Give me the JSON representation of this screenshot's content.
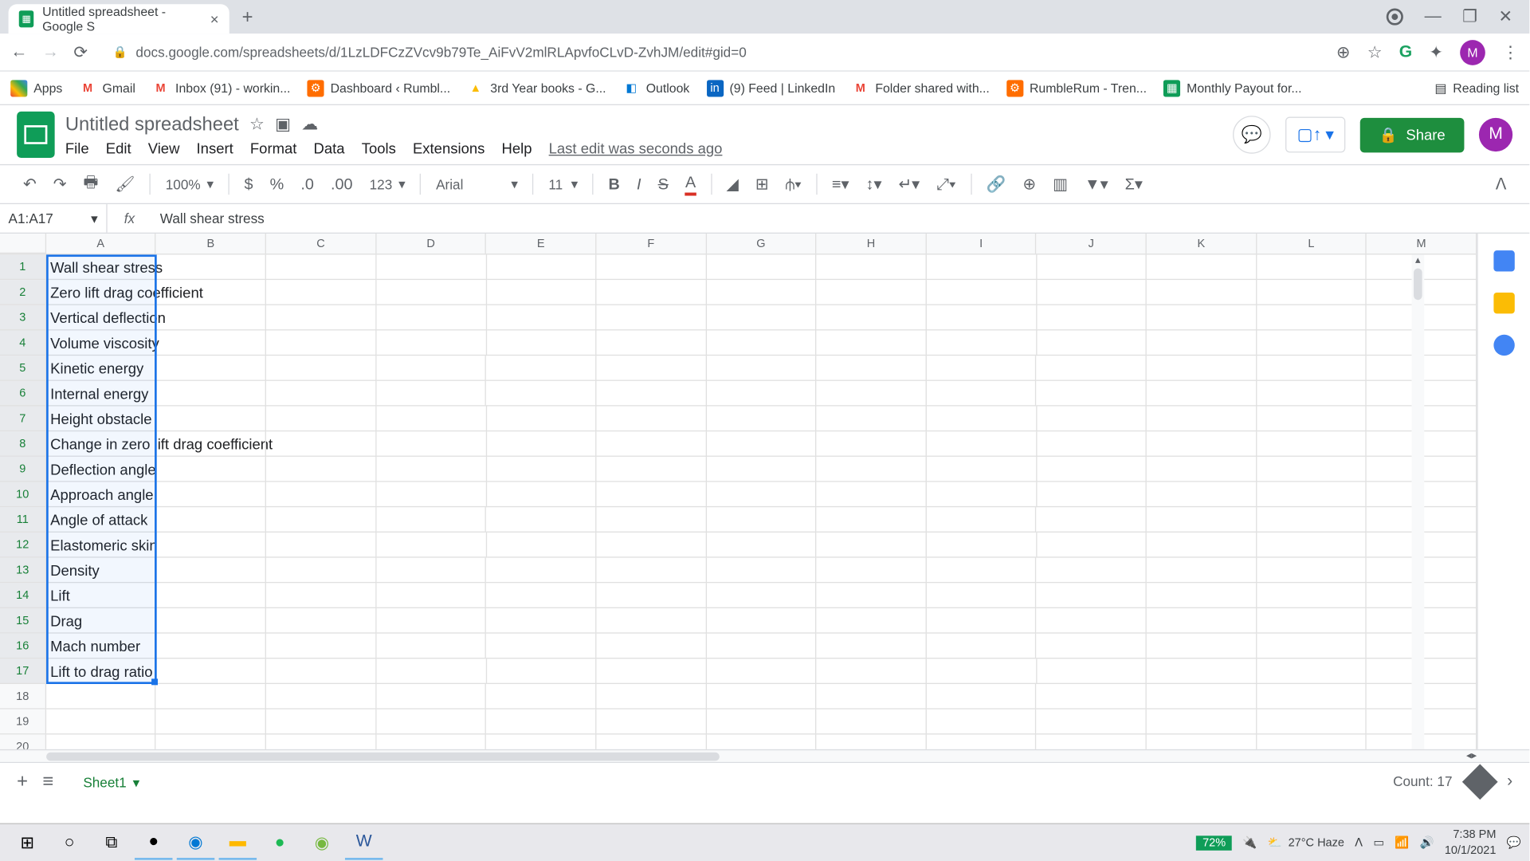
{
  "browser": {
    "tab_title": "Untitled spreadsheet - Google S",
    "url": "docs.google.com/spreadsheets/d/1LzLDFCzZVcv9b79Te_AiFvV2mlRLApvfoCLvD-ZvhJM/edit#gid=0",
    "bookmarks": [
      {
        "label": "Apps",
        "icon": "apps"
      },
      {
        "label": "Gmail",
        "icon": "gmail"
      },
      {
        "label": "Inbox (91) - workin...",
        "icon": "gmail"
      },
      {
        "label": "Dashboard ‹ Rumbl...",
        "icon": "orange"
      },
      {
        "label": "3rd Year books - G...",
        "icon": "drive"
      },
      {
        "label": "Outlook",
        "icon": "outlook"
      },
      {
        "label": "(9) Feed | LinkedIn",
        "icon": "linkedin"
      },
      {
        "label": "Folder shared with...",
        "icon": "gmail"
      },
      {
        "label": "RumbleRum - Tren...",
        "icon": "orange"
      },
      {
        "label": "Monthly Payout for...",
        "icon": "sheets"
      }
    ],
    "reading_list": "Reading list"
  },
  "sheets": {
    "title": "Untitled spreadsheet",
    "menus": [
      "File",
      "Edit",
      "View",
      "Insert",
      "Format",
      "Data",
      "Tools",
      "Extensions",
      "Help"
    ],
    "last_edit": "Last edit was seconds ago",
    "share": "Share",
    "zoom": "100%",
    "font": "Arial",
    "font_size": "11",
    "more_formats": "123",
    "name_box": "A1:A17",
    "formula": "Wall shear stress",
    "columns": [
      "A",
      "B",
      "C",
      "D",
      "E",
      "F",
      "G",
      "H",
      "I",
      "J",
      "K",
      "L",
      "M"
    ],
    "rows_shown": 20,
    "cells": {
      "A1": "Wall shear stress",
      "A2": "Zero lift drag coefficient",
      "A3": "Vertical deflection",
      "A4": "Volume viscosity",
      "A5": "Kinetic energy",
      "A6": "Internal energy",
      "A7": "Height obstacle",
      "A8": "Change in zero lift drag coefficient",
      "A9": "Deflection angle",
      "A10": "Approach angle",
      "A11": "Angle of attack",
      "A12": "Elastomeric skin",
      "A13": "Density",
      "A14": "Lift",
      "A15": "Drag",
      "A16": "Mach number",
      "A17": "Lift to drag ratio"
    },
    "sheet_tab": "Sheet1",
    "count": "Count: 17"
  },
  "taskbar": {
    "battery": "72%",
    "weather": "27°C Haze",
    "time": "7:38 PM",
    "date": "10/1/2021"
  }
}
